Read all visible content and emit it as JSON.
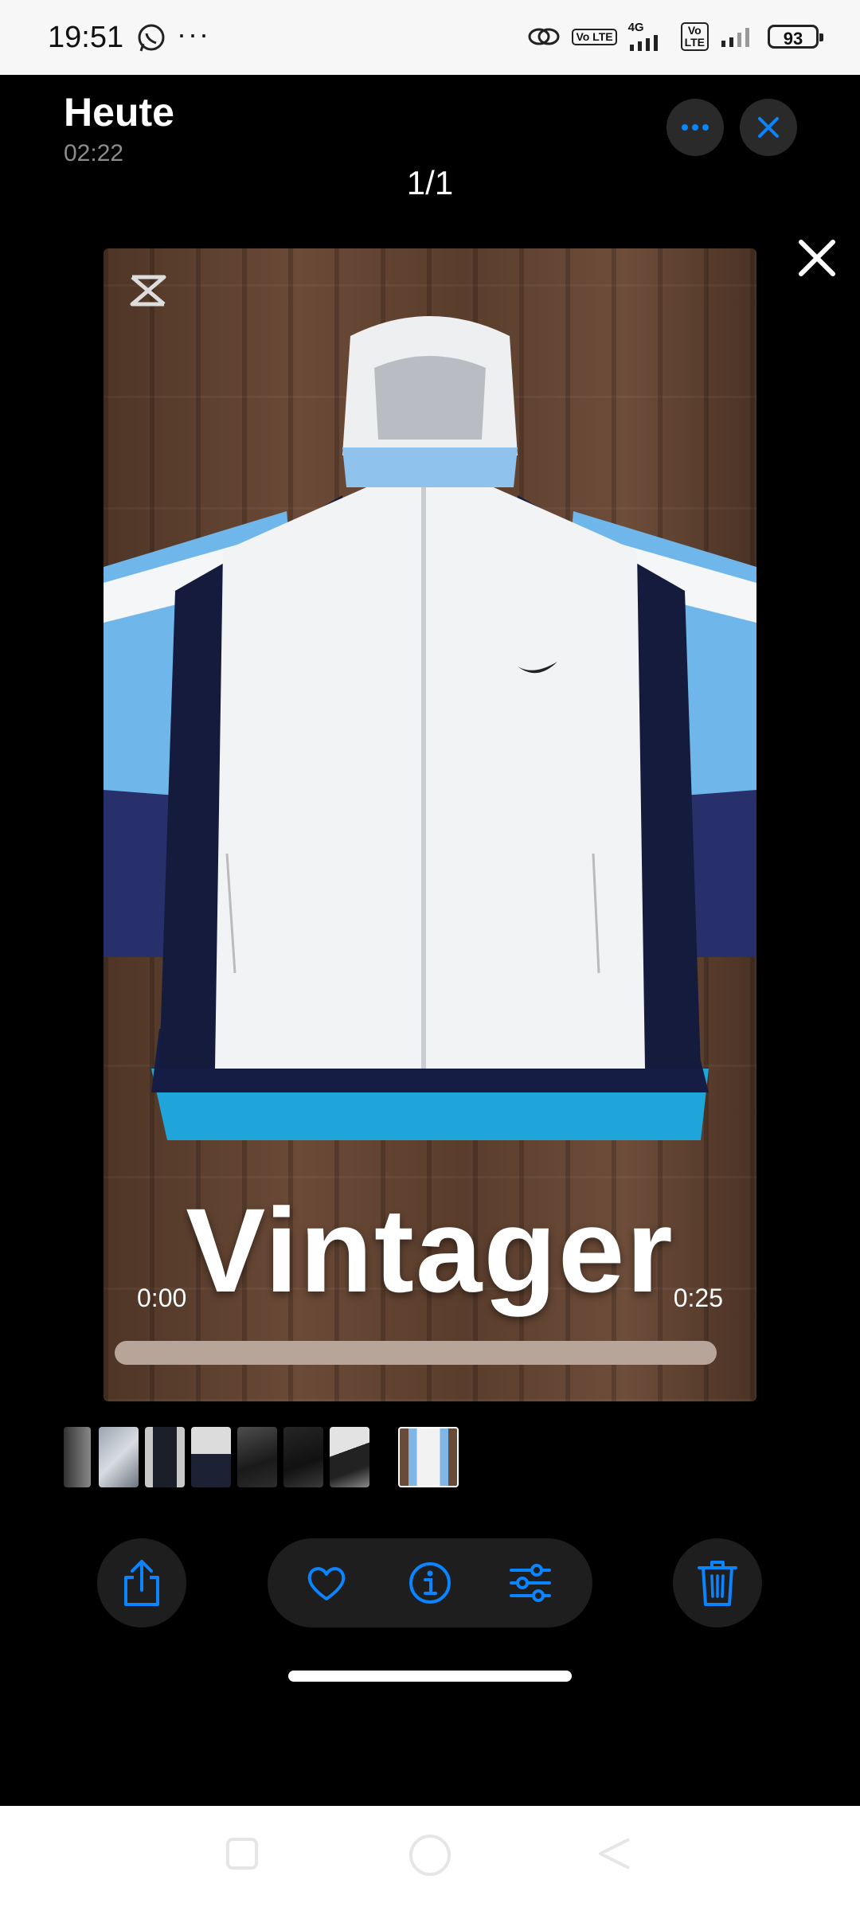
{
  "status_bar": {
    "time": "19:51",
    "dots": "···",
    "network_type": "4G",
    "volte_label": "Vo LTE",
    "battery": "93"
  },
  "header": {
    "title": "Heute",
    "subtitle": "02:22",
    "counter": "1/1"
  },
  "video": {
    "overlay_text": "Vintager",
    "time_current": "0:00",
    "time_total": "0:25",
    "progress": 0.0
  },
  "thumbnails": {
    "count": 8,
    "selected_index": 7
  },
  "actions": {
    "share": "share-icon",
    "favorite": "heart-icon",
    "info": "info-icon",
    "adjust": "sliders-icon",
    "delete": "trash-icon"
  },
  "colors": {
    "accent": "#0a84ff",
    "background": "#000000",
    "button_bg": "#1e1e1e"
  }
}
